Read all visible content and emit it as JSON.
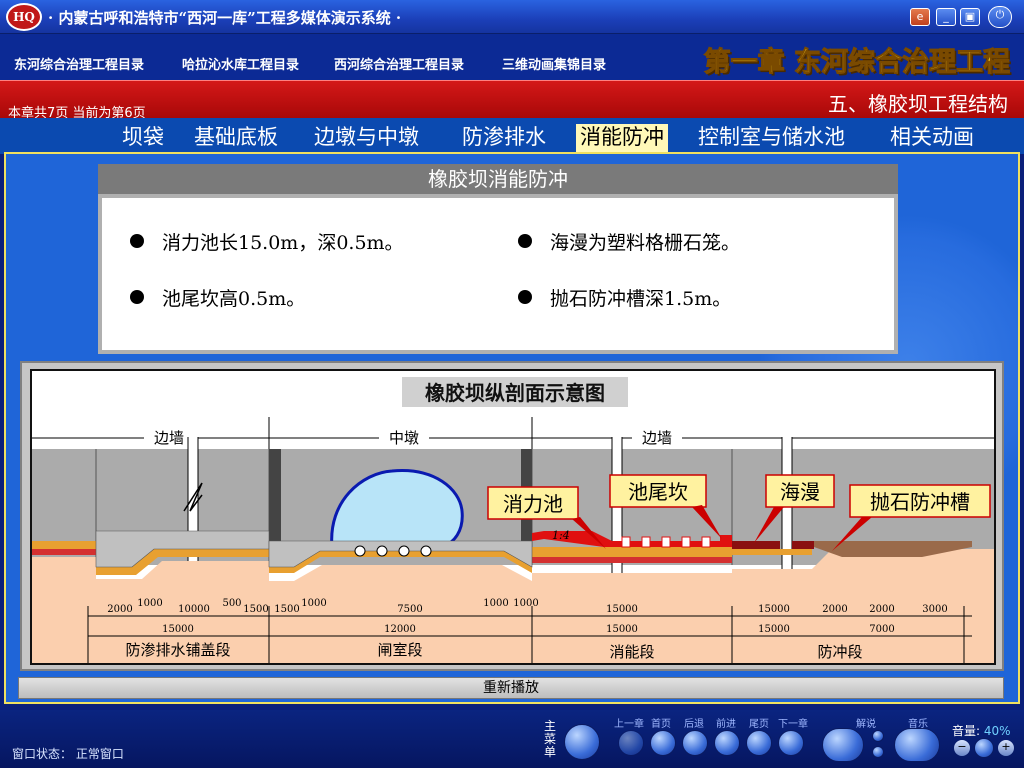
{
  "app": {
    "logo_text": "HQ",
    "title": "· 内蒙古呼和浩特市“西河一库”工程多媒体演示系统 ·"
  },
  "menu": {
    "items": [
      "东河综合治理工程目录",
      "哈拉沁水库工程目录",
      "西河综合治理工程目录",
      "三维动画集锦目录"
    ],
    "chapter_title": "第一章 东河综合治理工程"
  },
  "header": {
    "page_info": "本章共7页   当前为第6页",
    "section_title": "五、橡胶坝工程结构"
  },
  "tabs": [
    {
      "label": "坝袋"
    },
    {
      "label": "基础底板"
    },
    {
      "label": "边墩与中墩"
    },
    {
      "label": "防渗排水"
    },
    {
      "label": "消能防冲"
    },
    {
      "label": "控制室与储水池"
    },
    {
      "label": "相关动画"
    }
  ],
  "card": {
    "title": "橡胶坝消能防冲",
    "bullets": [
      "消力池长15.0m，深0.5m。",
      "海漫为塑料格栅石笼。",
      "池尾坎高0.5m。",
      "抛石防冲槽深1.5m。"
    ]
  },
  "diagram": {
    "title": "橡胶坝纵剖面示意图",
    "top_labels": [
      "边墙",
      "中墩",
      "边墙"
    ],
    "callouts": [
      "消力池",
      "池尾坎",
      "海漫",
      "抛石防冲槽"
    ],
    "slope": "1:4",
    "dims_row1": [
      "2000",
      "1000",
      "10000",
      "500",
      "1500",
      "1500",
      "1000",
      "7500",
      "1000",
      "1000",
      "15000",
      "15000",
      "2000",
      "2000",
      "3000"
    ],
    "dims_row2": [
      "15000",
      "12000",
      "15000",
      "15000",
      "7000"
    ],
    "segments": [
      "防渗排水铺盖段",
      "闸室段",
      "消能段",
      "防冲段"
    ]
  },
  "replay_label": "重新播放",
  "footer": {
    "status": "窗口状态：  正常窗口",
    "main_menu": "主菜单",
    "nav": [
      "上一章",
      "首页",
      "后退",
      "前进",
      "尾页",
      "下一章"
    ],
    "explain": "解说",
    "music": "音乐",
    "volume_label": "音量:",
    "volume_value": "40%"
  },
  "colors": {
    "title_bar": "#1b3fb8",
    "red_bar": "#c81010",
    "chapter_text": "#ffd820",
    "active_tab": "#fff8b8",
    "callout_bg": "#fff2a0",
    "callout_border": "#cc0000"
  }
}
